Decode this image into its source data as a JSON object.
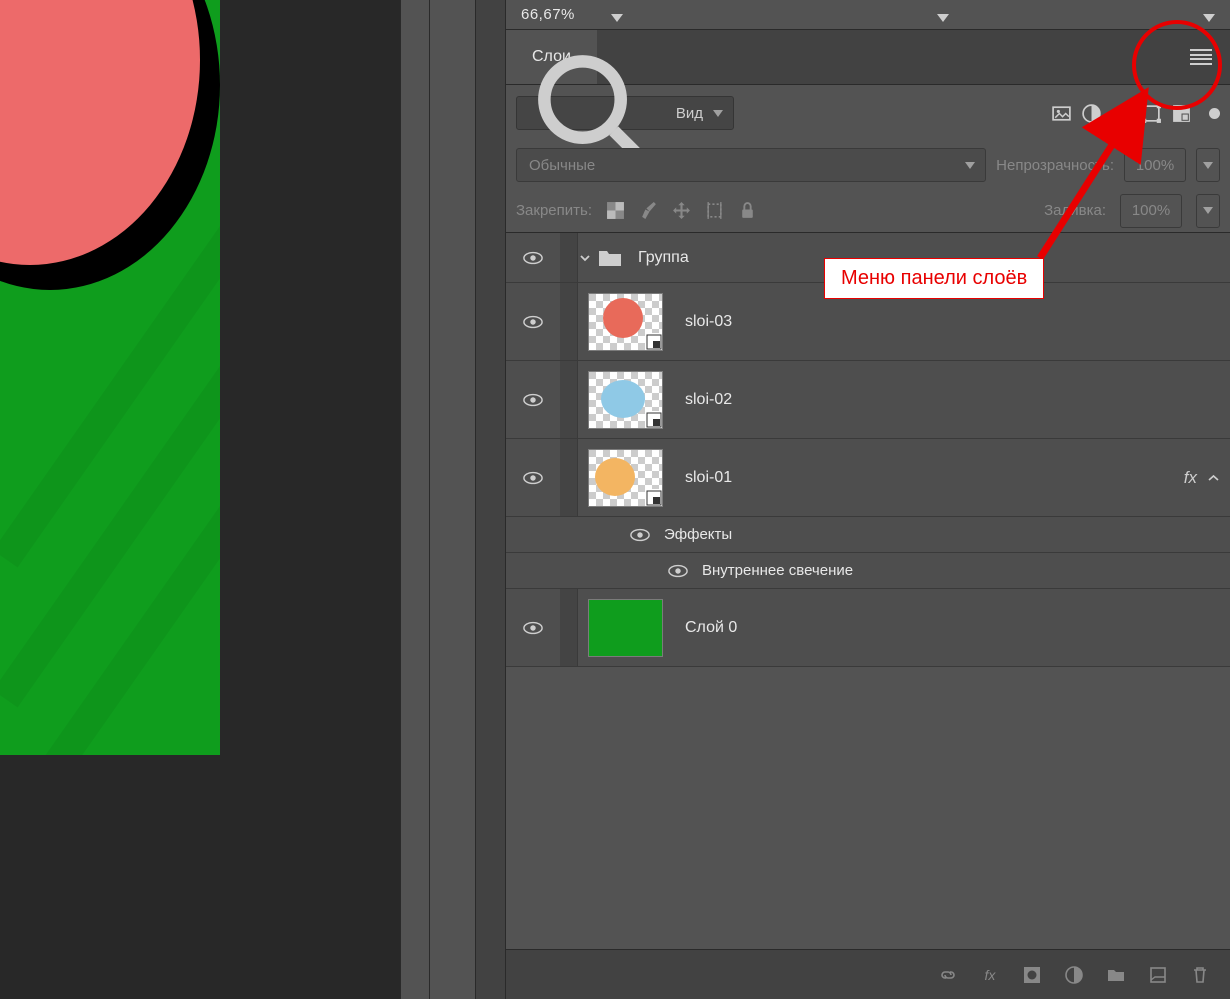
{
  "zoom": "66,67%",
  "panel": {
    "tab": "Слои"
  },
  "search": {
    "label": "Вид"
  },
  "filter": {},
  "blend": {
    "mode": "Обычные",
    "opacity_label": "Непрозрачность:",
    "opacity": "100%"
  },
  "lock": {
    "label": "Закрепить:",
    "fill_label": "Заливка:",
    "fill": "100%"
  },
  "layers": {
    "group": "Группа",
    "items": [
      {
        "name": "sloi-03"
      },
      {
        "name": "sloi-02"
      },
      {
        "name": "sloi-01",
        "fx": "fx"
      },
      {
        "name": "Слой 0"
      }
    ],
    "effects_label": "Эффекты",
    "effect1": "Внутреннее свечение"
  },
  "annotation": "Меню панели слоёв"
}
